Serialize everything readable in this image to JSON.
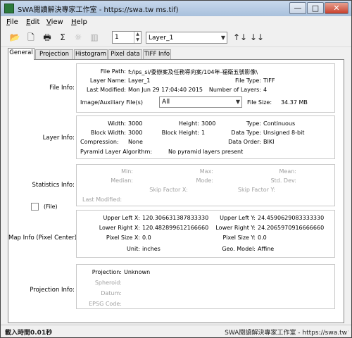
{
  "window": {
    "title": "SWA閱讀解決專家工作室 - https://swa.tw ms.tif)",
    "controls": {
      "min": "—",
      "max": "□",
      "close": "✕"
    }
  },
  "menu": {
    "file": {
      "u": "F",
      "rest": "ile"
    },
    "edit": {
      "u": "E",
      "rest": "dit"
    },
    "view": {
      "u": "V",
      "rest": "iew"
    },
    "help": {
      "u": "H",
      "rest": "elp"
    }
  },
  "toolbar": {
    "icons": {
      "open": "📂",
      "new": "🗋",
      "print": "🖶",
      "sigma": "Σ",
      "settings": "☼",
      "histogram": "▥",
      "sort_asc": "↑↓",
      "sort_desc": "↓↓"
    },
    "band_number": "1",
    "layer_select": "Layer_1"
  },
  "tabs": [
    "General",
    "Projection",
    "Histogram",
    "Pixel data",
    "TIFF Info"
  ],
  "file_info": {
    "section": "File Info:",
    "file_path_label": "File Path:",
    "file_path": "f:/ips_si/委辦案及任務導向案/104年-福衛五號影像\\",
    "layer_name_label": "Layer Name:",
    "layer_name": "Layer_1",
    "file_type_label": "File Type:",
    "file_type": "TIFF",
    "last_modified_label": "Last Modified:",
    "last_modified": "Mon Jun 29 17:04:40 2015",
    "num_layers_label": "Number of Layers:",
    "num_layers": "4",
    "aux_label": "Image/Auxiliary File(s)",
    "aux_value": "All",
    "file_size_label": "File Size:",
    "file_size": "34.37 MB"
  },
  "layer_info": {
    "section": "Layer Info:",
    "width_label": "Width:",
    "width": "3000",
    "height_label": "Height:",
    "height": "3000",
    "type_label": "Type:",
    "type": "Continuous",
    "block_width_label": "Block Width:",
    "block_width": "3000",
    "block_height_label": "Block Height:",
    "block_height": "1",
    "data_type_label": "Data Type:",
    "data_type": "Unsigned 8-bit",
    "compression_label": "Compression:",
    "compression": "None",
    "data_order_label": "Data Order:",
    "data_order": "BIKI",
    "pyramid_label": "Pyramid Layer Algorithm:",
    "pyramid": "No pyramid layers present"
  },
  "stats": {
    "section": "Statistics Info:",
    "min": "Min:",
    "max": "Max:",
    "mean": "Mean:",
    "median": "Median:",
    "mode": "Mode:",
    "std": "Std. Dev:",
    "skip_x": "Skip Factor X:",
    "skip_y": "Skip Factor Y:",
    "last_modified": "Last Modified:",
    "file_checkbox": "(File)"
  },
  "map_info": {
    "section": "Map Info (Pixel Center):",
    "upper_left_x_label": "Upper Left X:",
    "upper_left_x": "120.306631387833330",
    "upper_left_y_label": "Upper Left Y:",
    "upper_left_y": "24.4590629083333330",
    "lower_right_x_label": "Lower Right X:",
    "lower_right_x": "120.482899612166660",
    "lower_right_y_label": "Lower Right Y:",
    "lower_right_y": "24.2065970916666660",
    "pixel_size_x_label": "Pixel Size X:",
    "pixel_size_x": "0.0",
    "pixel_size_y_label": "Pixel Size Y:",
    "pixel_size_y": "0.0",
    "unit_label": "Unit:",
    "unit": "inches",
    "geo_model_label": "Geo. Model:",
    "geo_model": "Affine"
  },
  "projection_info": {
    "section": "Projection Info:",
    "projection_label": "Projection:",
    "projection": "Unknown",
    "spheroid_label": "Spheroid:",
    "datum_label": "Datum:",
    "epsg_label": "EPSG Code:"
  },
  "status": {
    "left": "載入時間0.01秒",
    "right": "SWA閱讀解決專家工作室 - https://swa.tw"
  }
}
